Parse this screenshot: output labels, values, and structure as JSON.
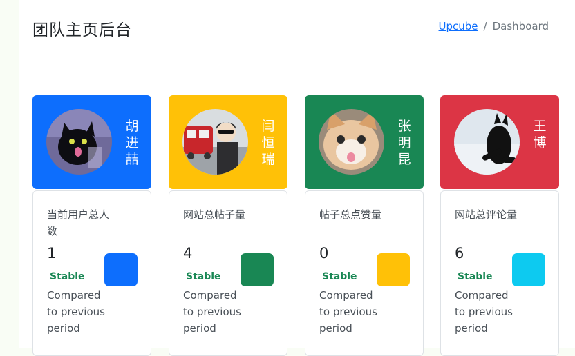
{
  "header": {
    "title": "团队主页后台",
    "breadcrumb": {
      "link": "Upcube",
      "separator": "/",
      "current": "Dashboard"
    }
  },
  "members": [
    {
      "name": "胡进喆",
      "color": "#0d6efd",
      "avatar": "black-cat-avatar"
    },
    {
      "name": "闫恒瑞",
      "color": "#ffc107",
      "avatar": "anime-boy-avatar"
    },
    {
      "name": "张明昆",
      "color": "#198754",
      "avatar": "orange-cat-avatar"
    },
    {
      "name": "王博",
      "color": "#dc3545",
      "avatar": "snow-cat-avatar"
    }
  ],
  "stats": [
    {
      "label": "当前用户总人数",
      "value": "1",
      "trend": "Stable",
      "note": "Compared to previous period",
      "color": "#0d6efd"
    },
    {
      "label": "网站总帖子量",
      "value": "4",
      "trend": "Stable",
      "note": "Compared to previous period",
      "color": "#198754"
    },
    {
      "label": "帖子总点赞量",
      "value": "0",
      "trend": "Stable",
      "note": "Compared to previous period",
      "color": "#ffc107"
    },
    {
      "label": "网站总评论量",
      "value": "6",
      "trend": "Stable",
      "note": "Compared to previous period",
      "color": "#0dcaf0"
    }
  ]
}
